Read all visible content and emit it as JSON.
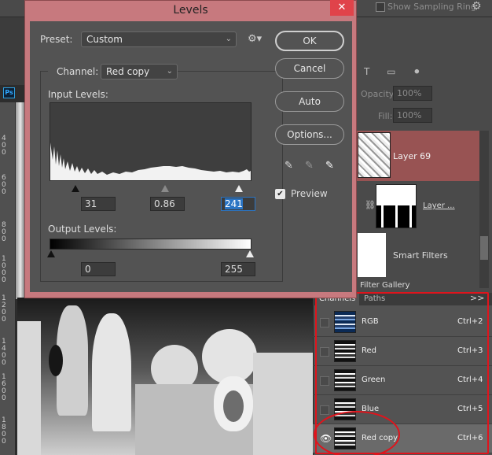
{
  "topbar": {
    "show_sampling_ring": "Show Sampling Ring"
  },
  "icons": {
    "top_gear": "gear-icon",
    "ps_badge": "Ps"
  },
  "ruler_numbers": [
    "4 0 0",
    "6 0 0",
    "8 0 0",
    "1 0 0 0",
    "1 2 0 0",
    "1 4 0 0",
    "1 6 0 0",
    "1 8 0 0"
  ],
  "layers_panel": {
    "tool_icons": "T ▭ ⚫",
    "opacity_label": "Opacity:",
    "opacity_value": "100%",
    "fill_label": "Fill:",
    "fill_value": "100%",
    "layer69": "Layer 69",
    "layer_mask_name": "Layer ...",
    "smart_filters": "Smart Filters",
    "filter_gallery": "Filter Gallery"
  },
  "channels_panel": {
    "tabs": [
      "Channels",
      "Paths"
    ],
    "menu": ">>",
    "rows": [
      {
        "name": "RGB",
        "shortcut": "Ctrl+2",
        "visible": false
      },
      {
        "name": "Red",
        "shortcut": "Ctrl+3",
        "visible": false
      },
      {
        "name": "Green",
        "shortcut": "Ctrl+4",
        "visible": false
      },
      {
        "name": "Blue",
        "shortcut": "Ctrl+5",
        "visible": false
      },
      {
        "name": "Red copy",
        "shortcut": "Ctrl+6",
        "visible": true
      }
    ]
  },
  "levels_dialog": {
    "title": "Levels",
    "close": "✕",
    "preset_label": "Preset:",
    "preset_value": "Custom",
    "channel_label": "Channel:",
    "channel_value": "Red copy",
    "input_levels_label": "Input Levels:",
    "input_black": "31",
    "input_gamma": "0.86",
    "input_white": "241",
    "output_levels_label": "Output Levels:",
    "output_black": "0",
    "output_white": "255",
    "buttons": {
      "ok": "OK",
      "cancel": "Cancel",
      "auto": "Auto",
      "options": "Options..."
    },
    "preview_label": "Preview",
    "preview_checked": true
  },
  "colors": {
    "dialog_frame": "#c7797e",
    "selected_layer": "#985353",
    "annotation": "#e0141c",
    "focus": "#2b75c4"
  }
}
